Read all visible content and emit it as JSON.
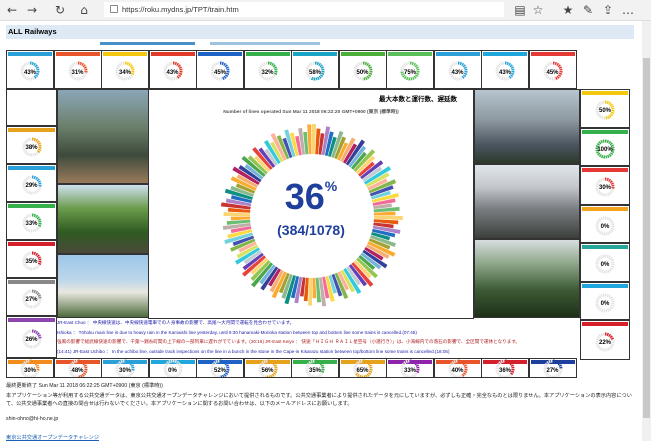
{
  "browser": {
    "url": "https://roku.mydns.jp/TPT/train.htm",
    "nav_icons": [
      "back-icon",
      "forward-icon",
      "refresh-icon",
      "home-icon"
    ],
    "right_icons": [
      "reading-view-icon",
      "favorite-star-icon",
      "favorites-list-icon",
      "pen-icon",
      "share-icon",
      "more-icon"
    ]
  },
  "page": {
    "title": "ALL Railways",
    "center_title": "最大本数と運行数、遅延数",
    "center_subtitle": "Number of lines operated Sun Mar 11 2018 06:22:20 GMT+0900 (東京 (標準時))",
    "center_percent": "36",
    "percent_sign": "%",
    "center_count": "(384/1078)"
  },
  "gauges": {
    "top": [
      {
        "pct": "43",
        "color": "#2aa0d8"
      },
      {
        "pct": "31",
        "color": "#e8552a"
      },
      {
        "pct": "34",
        "color": "#f2c80f"
      },
      {
        "pct": "43",
        "color": "#e23a2a"
      },
      {
        "pct": "45",
        "color": "#1f62c6"
      },
      {
        "pct": "32",
        "color": "#35b04a"
      },
      {
        "pct": "58",
        "color": "#19a3c4"
      },
      {
        "pct": "50",
        "color": "#4caf3a"
      },
      {
        "pct": "75",
        "color": "#5cc05a"
      },
      {
        "pct": "43",
        "color": "#2a9fd8"
      },
      {
        "pct": "43",
        "color": "#1fa6dc"
      },
      {
        "pct": "45",
        "color": "#e53935"
      }
    ],
    "left": [
      {
        "pct": "38",
        "color": "#e6a21c"
      },
      {
        "pct": "29",
        "color": "#2aa0d8"
      },
      {
        "pct": "33",
        "color": "#35b04a"
      },
      {
        "pct": "35",
        "color": "#d4202b"
      },
      {
        "pct": "27",
        "color": "#888888"
      },
      {
        "pct": "26",
        "color": "#8e44ad"
      }
    ],
    "right": [
      {
        "pct": "50",
        "color": "#f2c80f"
      },
      {
        "pct": "100",
        "color": "#35b04a"
      },
      {
        "pct": "30",
        "color": "#e53935"
      },
      {
        "pct": "0",
        "color": "#f2a51c"
      },
      {
        "pct": "0",
        "color": "#26a69a"
      },
      {
        "pct": "0",
        "color": "#1fa6dc"
      },
      {
        "pct": "22",
        "color": "#d4202b"
      }
    ],
    "bottom": [
      {
        "pct": "30",
        "color": "#f28c1c"
      },
      {
        "pct": "48",
        "color": "#e8552a"
      },
      {
        "pct": "30",
        "color": "#2aa0d8"
      },
      {
        "pct": "0",
        "color": "#1fa6dc"
      },
      {
        "pct": "52",
        "color": "#1f62c6"
      },
      {
        "pct": "56",
        "color": "#e6a21c"
      },
      {
        "pct": "35",
        "color": "#35b04a"
      },
      {
        "pct": "65",
        "color": "#e6a21c"
      },
      {
        "pct": "33",
        "color": "#8e24aa"
      },
      {
        "pct": "40",
        "color": "#e8552a"
      },
      {
        "pct": "36",
        "color": "#d4202b"
      },
      {
        "pct": "27",
        "color": "#1f3f9c"
      }
    ]
  },
  "tickers": [
    {
      "text": "JR-East Chuo  ：  中央線快速は、中央線快速電車での人身事故の影響で、高尾〜大月間で運転を見合わせています。",
      "color": "#1a1aa8"
    },
    {
      "text": "Ishioka  ：  Tōhoku main line is due to heavy rain in the Kamaishi line yesterday, until 9:30 hanamaki-Morioka station between top and bottom line some trains is cancelled.(07:45)",
      "color": "#1a1aa8"
    },
    {
      "text": "強風の影響で総武線快速の影響で、千葉〜錦糸町間の上下線の一部列車に遅れがでています。(20:16)     JR-East Keiyo   ：   快速「ＨＩＧＨ ＲＡＩＬ星空号（小諸行き）」は、小海線内での落石の影響で、全区間で運休となります。",
      "color": "#b02020"
    },
    {
      "text": "(14:41)     JR-East Uchibo  ：  In the uchibo line, outside track inspections on the line in a bunch in the stone in the Cape-in Kisarazu station between top/bottom line some trains is cancelled.(18:05)",
      "color": "#1a1aa8"
    }
  ],
  "footer": {
    "updated": "最終更新終了 Sun Mar 11 2018 06:22:25 GMT+0900 (東京 (標準時))",
    "notice1": "本アプリケーション等が利用する公共交通データは、東京公共交通オープンデータチャレンジにおいて提供されるものです。公共交通事業者により提供されたデータを元にしていますが、必ずしも正確・完全なものとは限りません。本アプリケーションの表示内容について、公共交通事業者への直接の問合せは行わないでください。本アプリケーションに関するお問い合わせは、以下のメールアドレスにお願いします。",
    "email": "shin-ohno@hi-ho.ne.jp",
    "link": "東京公共交通オープンデータチャレンジ"
  },
  "donut_colors": [
    "#f4b400",
    "#e65100",
    "#c62828",
    "#6a1b9a",
    "#1565c0",
    "#00897b",
    "#2e7d32",
    "#9e9d24",
    "#f9a825",
    "#ef6c00",
    "#ad1457",
    "#283593",
    "#0277bd",
    "#43a047",
    "#8bc34a",
    "#ffb300",
    "#e53935",
    "#5e35b1",
    "#90a4ae",
    "#26c6da",
    "#d4e157",
    "#ff7043",
    "#7cb342",
    "#3949ab",
    "#00acc1",
    "#fdd835",
    "#f06292",
    "#8d6e63",
    "#66bb6a",
    "#ffa726"
  ],
  "donut_fill_fraction": 0.36
}
